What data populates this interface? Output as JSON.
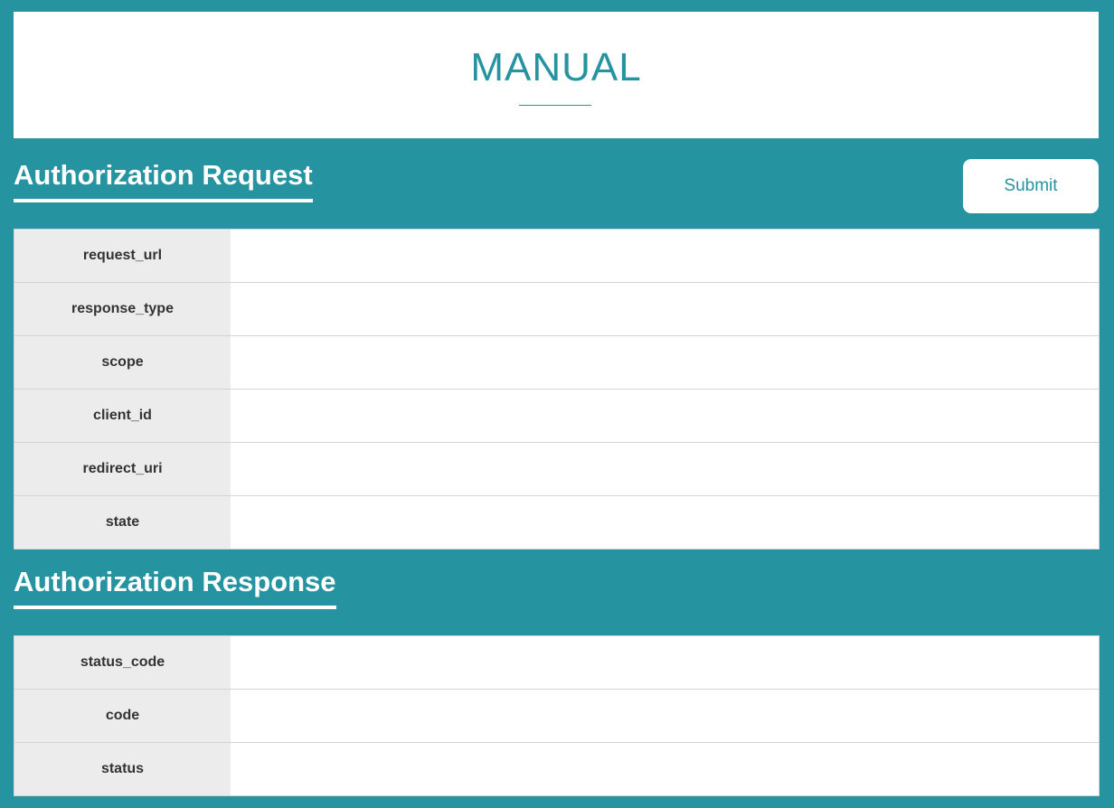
{
  "header": {
    "title": "MANUAL"
  },
  "request_section": {
    "title": "Authorization Request",
    "submit_label": "Submit",
    "fields": [
      {
        "label": "request_url",
        "value": ""
      },
      {
        "label": "response_type",
        "value": ""
      },
      {
        "label": "scope",
        "value": ""
      },
      {
        "label": "client_id",
        "value": ""
      },
      {
        "label": "redirect_uri",
        "value": ""
      },
      {
        "label": "state",
        "value": ""
      }
    ]
  },
  "response_section": {
    "title": "Authorization Response",
    "fields": [
      {
        "label": "status_code",
        "value": ""
      },
      {
        "label": "code",
        "value": ""
      },
      {
        "label": "status",
        "value": ""
      }
    ]
  },
  "colors": {
    "background": "#2594a0",
    "accent": "#2594a0",
    "label_bg": "#ececec",
    "border": "#d4d4d4"
  }
}
